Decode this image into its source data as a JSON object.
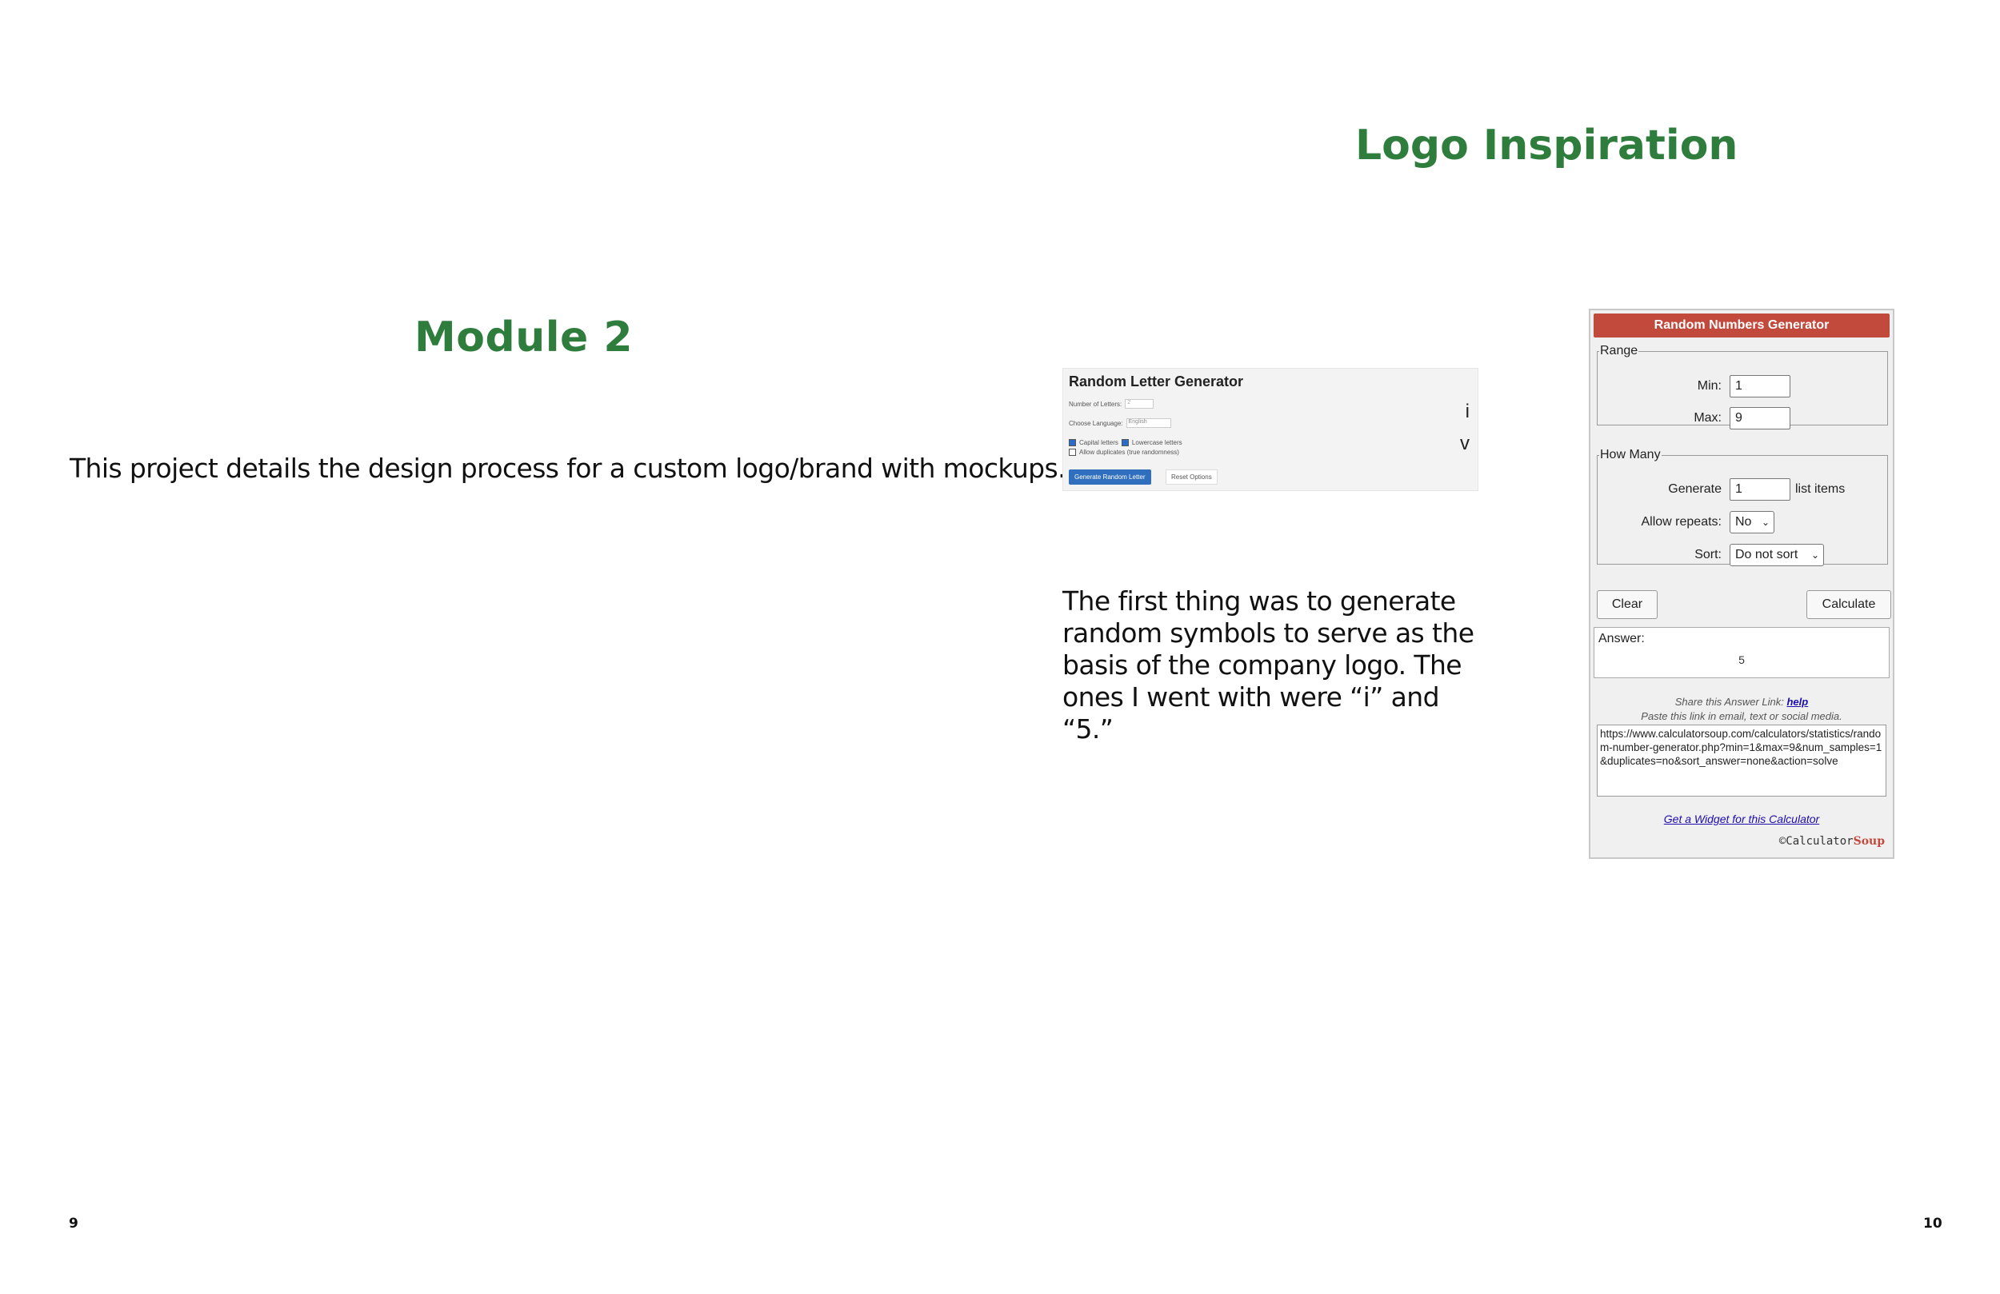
{
  "left_page": {
    "title": "Module 2",
    "description": "This project details the design process for a custom logo/brand with mockups.",
    "page_number": "9"
  },
  "right_page": {
    "title": "Logo Inspiration",
    "page_number": "10",
    "explanation": [
      "The first thing was to generate",
      "random symbols to serve as the",
      "basis of the company logo. The",
      "ones I went with were “i” and “5.”"
    ]
  },
  "letter_generator": {
    "title": "Random Letter Generator",
    "number_label": "Number of Letters:",
    "number_value": "2",
    "language_label": "Choose Language:",
    "language_value": "English",
    "capital_label": "Capital letters",
    "lowercase_label": "Lowercase letters",
    "duplicates_label": "Allow duplicates (true randomness)",
    "generate_button": "Generate Random Letter",
    "reset_button": "Reset Options",
    "results": [
      "i",
      "v"
    ]
  },
  "number_generator": {
    "header": "Random Numbers Generator",
    "range_legend": "Range",
    "min_label": "Min:",
    "min_value": "1",
    "max_label": "Max:",
    "max_value": "9",
    "howmany_legend": "How Many",
    "generate_label": "Generate",
    "generate_value": "1",
    "list_items_label": "list items",
    "repeats_label": "Allow repeats:",
    "repeats_value": "No",
    "sort_label": "Sort:",
    "sort_value": "Do not sort",
    "clear_button": "Clear",
    "calculate_button": "Calculate",
    "answer_label": "Answer:",
    "answer_value": "5",
    "share_text": "Share this Answer Link:",
    "share_help": "help",
    "paste_text": "Paste this link in email, text or social media.",
    "share_url": "https://www.calculatorsoup.com/calculators/statistics/random-number-generator.php?min=1&max=9&num_samples=1&duplicates=no&sort_answer=none&action=solve",
    "widget_link": "Get a Widget for this Calculator",
    "copyright_symbol": "©",
    "brand_calc": "Calculator",
    "brand_soup": "Soup"
  }
}
